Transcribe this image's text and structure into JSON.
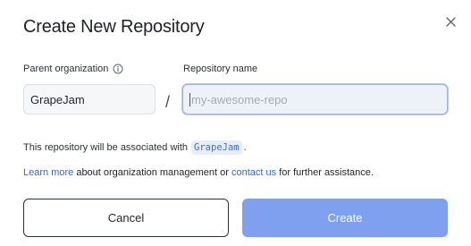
{
  "dialog": {
    "title": "Create New Repository",
    "close_icon": "close-icon"
  },
  "form": {
    "parent_label": "Parent organization",
    "parent_info_icon": "info-icon",
    "parent_value": "GrapeJam",
    "separator": "/",
    "repo_label": "Repository name",
    "repo_placeholder": "my-awesome-repo",
    "repo_value": ""
  },
  "association": {
    "text": "This repository will be associated with",
    "org_chip": "GrapeJam",
    "suffix": "."
  },
  "help": {
    "learn_more_link": "Learn more",
    "middle_text": " about organization management or ",
    "contact_link": "contact us",
    "end_text": " for further assistance."
  },
  "actions": {
    "cancel_label": "Cancel",
    "create_label": "Create"
  },
  "colors": {
    "accent": "#2f6ad1",
    "create_button": "#7ea0ef",
    "input_focus_border": "#9cb6dc"
  }
}
